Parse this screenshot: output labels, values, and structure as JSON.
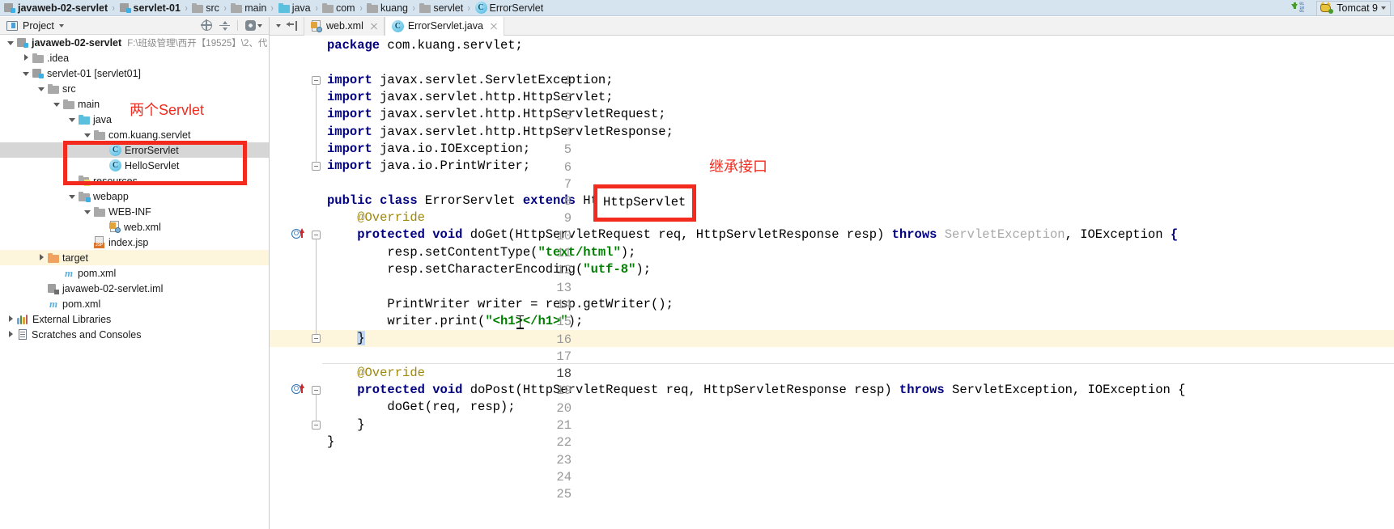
{
  "breadcrumb": [
    {
      "label": "javaweb-02-servlet",
      "icon": "module-icon",
      "bold": true
    },
    {
      "label": "servlet-01",
      "icon": "module-icon",
      "bold": true
    },
    {
      "label": "src",
      "icon": "folder-icon",
      "bold": false
    },
    {
      "label": "main",
      "icon": "folder-icon",
      "bold": false
    },
    {
      "label": "java",
      "icon": "folder-blue-icon",
      "bold": false
    },
    {
      "label": "com",
      "icon": "folder-icon",
      "bold": false
    },
    {
      "label": "kuang",
      "icon": "folder-icon",
      "bold": false
    },
    {
      "label": "servlet",
      "icon": "folder-icon",
      "bold": false
    },
    {
      "label": "ErrorServlet",
      "icon": "class-icon",
      "bold": false
    }
  ],
  "topright": {
    "download_icon": "download-binary-icon",
    "download_bits": [
      "01",
      "10",
      "01"
    ],
    "run_config": "Tomcat 9",
    "run_config_icon": "tomcat-cat-icon",
    "chevron": "chevron-down-icon"
  },
  "project_panel": {
    "title": "Project",
    "title_icon": "project-icon",
    "dropdown_icon": "chevron-down-icon",
    "actions": [
      "locate-target-icon",
      "collapse-all-icon",
      "settings-gear-icon"
    ]
  },
  "tree": [
    {
      "depth": 0,
      "twist": "down",
      "icon": "module-icon",
      "label": "javaweb-02-servlet",
      "bold": true,
      "path": "F:\\班级管理\\西开【19525】\\2、代",
      "state": "normal"
    },
    {
      "depth": 1,
      "twist": "right",
      "icon": "folder-icon",
      "label": ".idea",
      "bold": false,
      "path": "",
      "state": "normal"
    },
    {
      "depth": 1,
      "twist": "down",
      "icon": "module-icon",
      "label": "servlet-01 [servlet01]",
      "bold": false,
      "path": "",
      "state": "normal"
    },
    {
      "depth": 2,
      "twist": "down",
      "icon": "folder-icon",
      "label": "src",
      "bold": false,
      "path": "",
      "state": "normal"
    },
    {
      "depth": 3,
      "twist": "down",
      "icon": "folder-icon",
      "label": "main",
      "bold": false,
      "path": "",
      "state": "normal"
    },
    {
      "depth": 4,
      "twist": "down",
      "icon": "folder-blue-icon",
      "label": "java",
      "bold": false,
      "path": "",
      "state": "normal"
    },
    {
      "depth": 5,
      "twist": "down",
      "icon": "package-icon",
      "label": "com.kuang.servlet",
      "bold": false,
      "path": "",
      "state": "normal"
    },
    {
      "depth": 6,
      "twist": "none",
      "icon": "class-icon",
      "label": "ErrorServlet",
      "bold": false,
      "path": "",
      "state": "selected"
    },
    {
      "depth": 6,
      "twist": "none",
      "icon": "class-icon",
      "label": "HelloServlet",
      "bold": false,
      "path": "",
      "state": "normal"
    },
    {
      "depth": 4,
      "twist": "none",
      "icon": "resources-icon",
      "label": "resources",
      "bold": false,
      "path": "",
      "state": "normal"
    },
    {
      "depth": 4,
      "twist": "down",
      "icon": "folder-web-icon",
      "label": "webapp",
      "bold": false,
      "path": "",
      "state": "normal"
    },
    {
      "depth": 5,
      "twist": "down",
      "icon": "folder-icon",
      "label": "WEB-INF",
      "bold": false,
      "path": "",
      "state": "normal"
    },
    {
      "depth": 6,
      "twist": "none",
      "icon": "xml-file-icon",
      "label": "web.xml",
      "bold": false,
      "path": "",
      "state": "normal"
    },
    {
      "depth": 5,
      "twist": "none",
      "icon": "jsp-file-icon",
      "label": "index.jsp",
      "bold": false,
      "path": "",
      "state": "normal"
    },
    {
      "depth": 2,
      "twist": "right",
      "icon": "folder-orange-icon",
      "label": "target",
      "bold": false,
      "path": "",
      "state": "highlighted"
    },
    {
      "depth": 3,
      "twist": "none",
      "icon": "maven-icon",
      "label": "pom.xml",
      "bold": false,
      "path": "",
      "state": "normal"
    },
    {
      "depth": 2,
      "twist": "none",
      "icon": "iml-file-icon",
      "label": "javaweb-02-servlet.iml",
      "bold": false,
      "path": "",
      "state": "normal"
    },
    {
      "depth": 2,
      "twist": "none",
      "icon": "maven-icon",
      "label": "pom.xml",
      "bold": false,
      "path": "",
      "state": "normal"
    },
    {
      "depth": 0,
      "twist": "right",
      "icon": "library-icon",
      "label": "External Libraries",
      "bold": false,
      "path": "",
      "state": "normal"
    },
    {
      "depth": 0,
      "twist": "right",
      "icon": "scratch-icon",
      "label": "Scratches and Consoles",
      "bold": false,
      "path": "",
      "state": "normal"
    }
  ],
  "editor_tabs": {
    "controls": [
      "chevron-down-icon",
      "jump-to-source-icon"
    ],
    "tabs": [
      {
        "label": "web.xml",
        "icon": "xml-file-icon",
        "active": false,
        "close": "close-icon"
      },
      {
        "label": "ErrorServlet.java",
        "icon": "class-icon",
        "active": true,
        "close": "close-icon"
      }
    ]
  },
  "code": {
    "filename": "ErrorServlet.java",
    "current_line": 18,
    "lines": [
      {
        "n": 1,
        "tokens": [
          {
            "t": "package ",
            "c": "kw"
          },
          {
            "t": "com.kuang.servlet;",
            "c": "plain"
          }
        ]
      },
      {
        "n": 2,
        "tokens": []
      },
      {
        "n": 3,
        "tokens": [
          {
            "t": "import ",
            "c": "kw"
          },
          {
            "t": "javax.servlet.ServletException;",
            "c": "plain"
          }
        ],
        "fold": "open"
      },
      {
        "n": 4,
        "tokens": [
          {
            "t": "import ",
            "c": "kw"
          },
          {
            "t": "javax.servlet.http.HttpServlet;",
            "c": "plain"
          }
        ]
      },
      {
        "n": 5,
        "tokens": [
          {
            "t": "import ",
            "c": "kw"
          },
          {
            "t": "javax.servlet.http.HttpServletRequest;",
            "c": "plain"
          }
        ]
      },
      {
        "n": 6,
        "tokens": [
          {
            "t": "import ",
            "c": "kw"
          },
          {
            "t": "javax.servlet.http.HttpServletResponse;",
            "c": "plain"
          }
        ]
      },
      {
        "n": 7,
        "tokens": [
          {
            "t": "import ",
            "c": "kw"
          },
          {
            "t": "java.io.IOException;",
            "c": "plain"
          }
        ]
      },
      {
        "n": 8,
        "tokens": [
          {
            "t": "import ",
            "c": "kw"
          },
          {
            "t": "java.io.PrintWriter;",
            "c": "plain"
          }
        ],
        "fold": "end"
      },
      {
        "n": 9,
        "tokens": []
      },
      {
        "n": 10,
        "tokens": [
          {
            "t": "public class ",
            "c": "kw"
          },
          {
            "t": "ErrorServlet ",
            "c": "plain"
          },
          {
            "t": "extends ",
            "c": "kw"
          },
          {
            "t": "HttpServlet {",
            "c": "plain"
          }
        ]
      },
      {
        "n": 11,
        "tokens": [
          {
            "t": "    @Override",
            "c": "anno"
          }
        ]
      },
      {
        "n": 12,
        "tokens": [
          {
            "t": "    protected void ",
            "c": "kw"
          },
          {
            "t": "doGet(HttpServletRequest req, HttpServletResponse resp) ",
            "c": "plain"
          },
          {
            "t": "throws ",
            "c": "kw"
          },
          {
            "t": "ServletException",
            "c": "gray"
          },
          {
            "t": ", ",
            "c": "plain"
          },
          {
            "t": "IOException ",
            "c": "plain"
          },
          {
            "t": "{",
            "c": "kw"
          }
        ],
        "gutter": "override-marker",
        "fold": "open"
      },
      {
        "n": 13,
        "tokens": [
          {
            "t": "        resp.setContentType(",
            "c": "plain"
          },
          {
            "t": "\"text/html\"",
            "c": "str"
          },
          {
            "t": ");",
            "c": "plain"
          }
        ]
      },
      {
        "n": 14,
        "tokens": [
          {
            "t": "        resp.setCharacterEncoding(",
            "c": "plain"
          },
          {
            "t": "\"utf-8\"",
            "c": "str"
          },
          {
            "t": ");",
            "c": "plain"
          }
        ]
      },
      {
        "n": 15,
        "tokens": []
      },
      {
        "n": 16,
        "tokens": [
          {
            "t": "        PrintWriter writer = resp.getWriter();",
            "c": "plain"
          }
        ]
      },
      {
        "n": 17,
        "tokens": [
          {
            "t": "        writer.print(",
            "c": "plain"
          },
          {
            "t": "\"<h1></h1>\"",
            "c": "str"
          },
          {
            "t": ");",
            "c": "plain"
          }
        ]
      },
      {
        "n": 18,
        "tokens": [
          {
            "t": "    }",
            "c": "brace"
          }
        ],
        "current": true,
        "fold": "end"
      },
      {
        "n": 19,
        "tokens": []
      },
      {
        "n": 20,
        "tokens": [
          {
            "t": "    @Override",
            "c": "anno"
          }
        ]
      },
      {
        "n": 21,
        "tokens": [
          {
            "t": "    protected void ",
            "c": "kw"
          },
          {
            "t": "doPost(HttpServletRequest req, HttpServletResponse resp) ",
            "c": "plain"
          },
          {
            "t": "throws ",
            "c": "kw"
          },
          {
            "t": "ServletException, IOException {",
            "c": "plain"
          }
        ],
        "gutter": "override-marker",
        "fold": "open"
      },
      {
        "n": 22,
        "tokens": [
          {
            "t": "        doGet(req, resp);",
            "c": "plain"
          }
        ]
      },
      {
        "n": 23,
        "tokens": [
          {
            "t": "    }",
            "c": "plain"
          }
        ],
        "fold": "end"
      },
      {
        "n": 24,
        "tokens": [
          {
            "t": "}",
            "c": "plain"
          }
        ]
      },
      {
        "n": 25,
        "tokens": []
      }
    ]
  },
  "annotations": {
    "color": "#f22b1e",
    "note_servlets": "两个Servlet",
    "note_interface": "继承接口",
    "highlight_class": "HttpServlet"
  }
}
